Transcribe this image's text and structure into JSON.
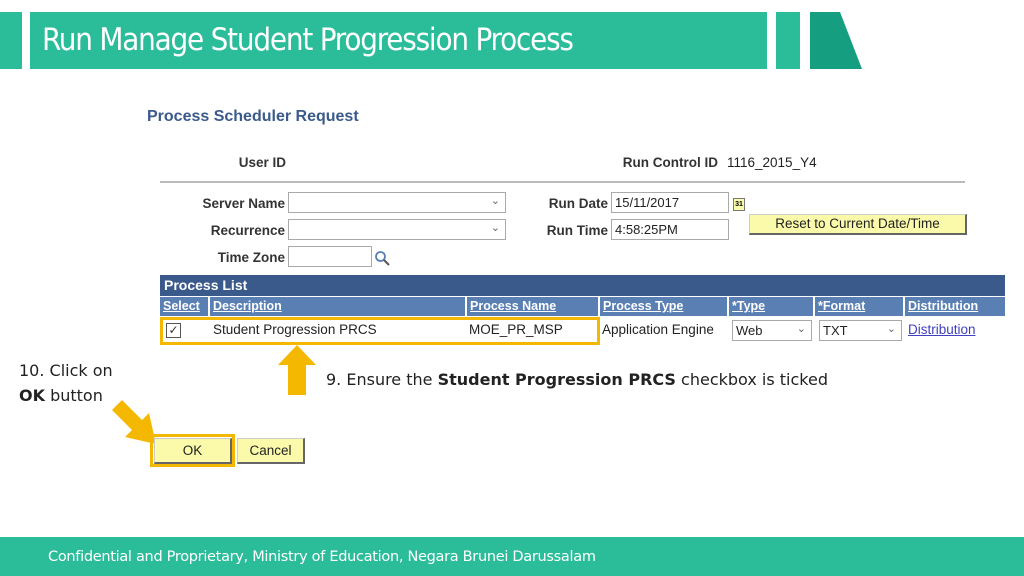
{
  "slide": {
    "title": "Run Manage Student Progression Process",
    "footer": "Confidential and Proprietary, Ministry of Education, Negara Brunei Darussalam",
    "accent": "#2bbc9a",
    "highlight": "#f5b800"
  },
  "form": {
    "heading": "Process Scheduler Request",
    "user_id_label": "User ID",
    "run_control_label": "Run Control ID",
    "run_control_value": "1116_2015_Y4",
    "server_name_label": "Server Name",
    "server_name_value": "",
    "recurrence_label": "Recurrence",
    "recurrence_value": "",
    "time_zone_label": "Time Zone",
    "time_zone_value": "",
    "run_date_label": "Run Date",
    "run_date_value": "15/11/2017",
    "run_time_label": "Run Time",
    "run_time_value": "4:58:25PM",
    "reset_button": "Reset to Current Date/Time",
    "process_list_title": "Process List",
    "columns": [
      "Select",
      "Description",
      "Process Name",
      "Process Type",
      "*Type",
      "*Format",
      "Distribution"
    ],
    "row": {
      "selected": true,
      "description": "Student Progression PRCS",
      "process_name": "MOE_PR_MSP",
      "process_type": "Application Engine",
      "type": "Web",
      "format": "TXT",
      "distribution": "Distribution"
    },
    "ok_button": "OK",
    "cancel_button": "Cancel"
  },
  "notes": {
    "step10_a": "10. Click on",
    "step10_bold": "OK",
    "step10_b": " button",
    "step9_a": "9. Ensure the ",
    "step9_bold": "Student Progression PRCS",
    "step9_b": " checkbox is ticked"
  }
}
